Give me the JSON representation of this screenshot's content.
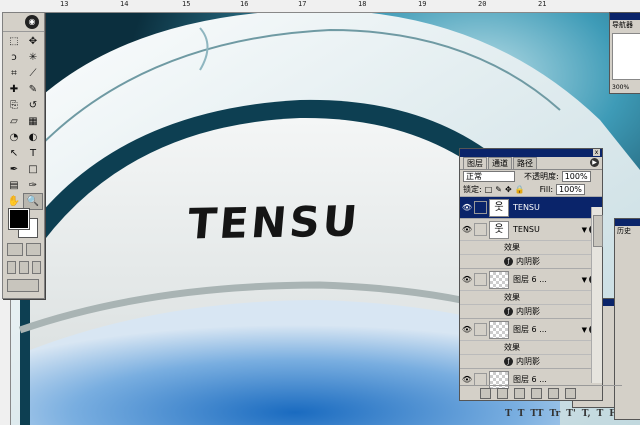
{
  "ruler_top": [
    "13",
    "14",
    "15",
    "16",
    "17",
    "18",
    "19",
    "20",
    "21"
  ],
  "canvas": {
    "logo_text": "TENSU"
  },
  "toolbox": {
    "tools": [
      "marquee-icon",
      "move-icon",
      "lasso-icon",
      "magic-wand-icon",
      "crop-icon",
      "slice-icon",
      "healing-brush-icon",
      "brush-icon",
      "clone-stamp-icon",
      "history-brush-icon",
      "eraser-icon",
      "gradient-icon",
      "blur-icon",
      "dodge-icon",
      "path-select-icon",
      "type-icon",
      "pen-icon",
      "shape-icon",
      "notes-icon",
      "eyedropper-icon",
      "hand-icon",
      "zoom-icon"
    ],
    "glyphs": [
      "⬚",
      "✥",
      "ↄ",
      "✳",
      "⌗",
      "⟋",
      "✚",
      "✎",
      "⎘",
      "↺",
      "▱",
      "▦",
      "◔",
      "◐",
      "↖",
      "T",
      "✒",
      "□",
      "▤",
      "✑",
      "✋",
      "🔍"
    ]
  },
  "layers_panel": {
    "tabs": [
      "图层",
      "通道",
      "路径"
    ],
    "blend_mode": "正常",
    "opacity_label": "不透明度:",
    "opacity_value": "100%",
    "lock_label": "锁定:",
    "fill_label": "Fill:",
    "fill_value": "100%",
    "layers": [
      {
        "name": "TENSU",
        "active": true
      },
      {
        "name": "TENSU",
        "active": false
      }
    ],
    "effects_label": "效果",
    "inner_shadow_label": "内阴影",
    "layer6_name": "图层 6 ...",
    "layer6_copy_name": "图层 6 ..."
  },
  "navigator": {
    "tab": "导航器",
    "zoom": "300%"
  },
  "history": {
    "tab": "历史"
  },
  "character": {
    "style_buttons": [
      "T",
      "T",
      "TT",
      "Tr",
      "T'",
      "T,",
      "T",
      "F"
    ]
  },
  "colors": {
    "title_bar": "#0a246a",
    "panel_bg": "#d4d0c8",
    "canvas_dark": "#0b2f3e",
    "canvas_teal": "#2c8aa8"
  }
}
